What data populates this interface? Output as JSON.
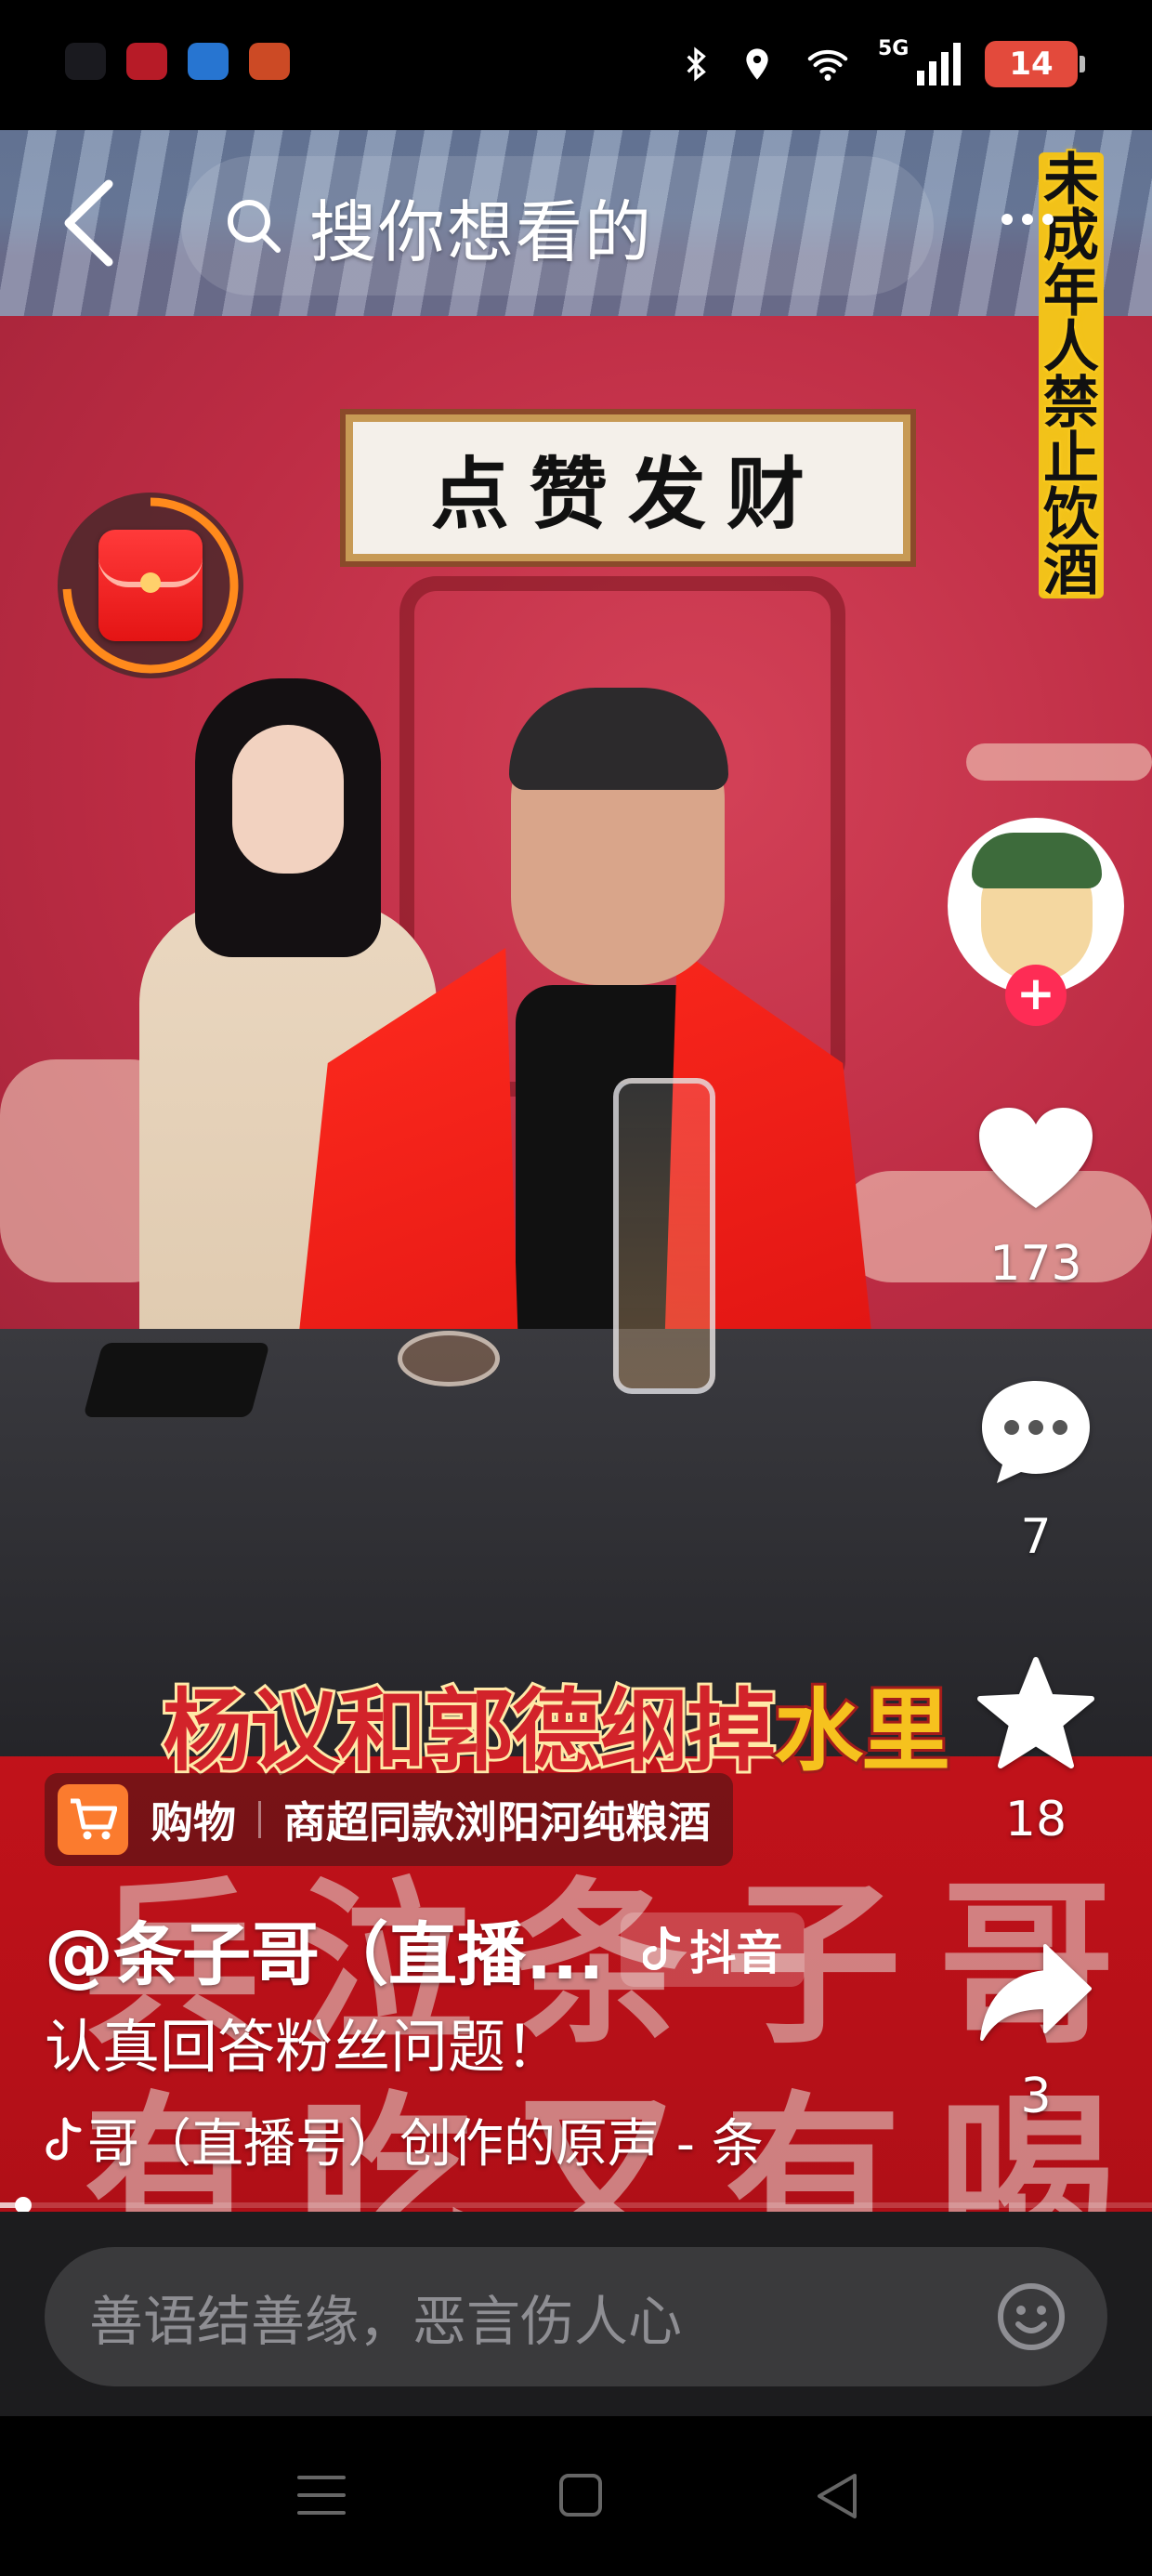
{
  "status_bar": {
    "battery": "14",
    "network": "5G",
    "app_icons": [
      "app-notification-1",
      "app-notification-2",
      "app-notification-3",
      "app-notification-4"
    ]
  },
  "top_bar": {
    "search_placeholder": "搜你想看的"
  },
  "video": {
    "sign_text": "点赞发财",
    "warning_text": "未成年人禁止饮酒",
    "caption_main": "杨议和郭德纲掉",
    "caption_highlight": "水里",
    "watermark_line1": "兵泣条子哥",
    "watermark_line2": "有吃又有喝"
  },
  "rail": {
    "like_count": "173",
    "comment_count": "7",
    "favorite_count": "18",
    "share_count": "3"
  },
  "shop": {
    "label": "购物",
    "title": "商超同款浏阳河纯粮酒"
  },
  "post": {
    "author": "@条子哥（直播...",
    "platform_badge": "抖音",
    "description": "认真回答粉丝问题！",
    "music": "哥（直播号）创作的原声 - 条"
  },
  "playback": {
    "progress": 0.02
  },
  "comment": {
    "placeholder": "善语结善缘，恶言伤人心"
  },
  "colors": {
    "accent_red": "#fe2c55",
    "shop_orange": "#fb7b2e",
    "warning_yellow": "#f2c21a"
  }
}
